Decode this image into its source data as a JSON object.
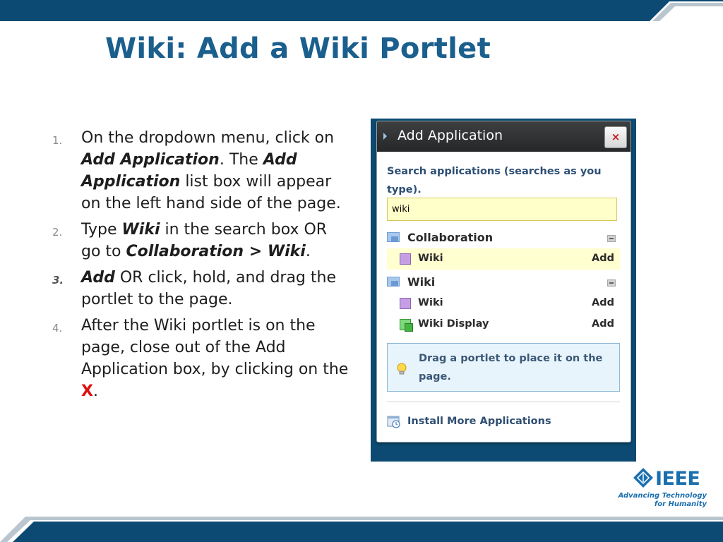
{
  "slide": {
    "title": "Wiki: Add a Wiki Portlet"
  },
  "steps": [
    {
      "number": "1.",
      "parts": [
        "On the dropdown menu, click on ",
        "Add Application",
        ". The ",
        "Add Application",
        " list box will appear on the left hand side of the page."
      ]
    },
    {
      "number": "2.",
      "parts": [
        "Type ",
        "Wiki",
        " in the search box OR go to ",
        "Collaboration > Wiki",
        "."
      ]
    },
    {
      "number": "3.",
      "parts": [
        "Add",
        " OR click, hold, and drag the portlet to the page."
      ]
    },
    {
      "number": "4.",
      "parts": [
        "After the Wiki portlet is on the page, close out of the Add Application box, by clicking on the ",
        "X",
        "."
      ]
    }
  ],
  "dialog": {
    "title": "Add Application",
    "close_label": "×",
    "search_label": "Search applications (searches as you type).",
    "search_value": "wiki",
    "categories": [
      {
        "label": "Collaboration",
        "apps": [
          {
            "label": "Wiki",
            "add_label": "Add"
          }
        ]
      },
      {
        "label": "Wiki",
        "apps": [
          {
            "label": "Wiki",
            "add_label": "Add"
          },
          {
            "label": "Wiki Display",
            "add_label": "Add"
          }
        ]
      }
    ],
    "hint": "Drag a portlet to place it on the page.",
    "install_label": "Install More Applications"
  },
  "logo": {
    "name": "IEEE",
    "tagline_1": "Advancing Technology",
    "tagline_2": "for Humanity"
  },
  "colors": {
    "title": "#1a5f8d",
    "banner": "#0c4a73",
    "accent_red": "#e01010"
  }
}
